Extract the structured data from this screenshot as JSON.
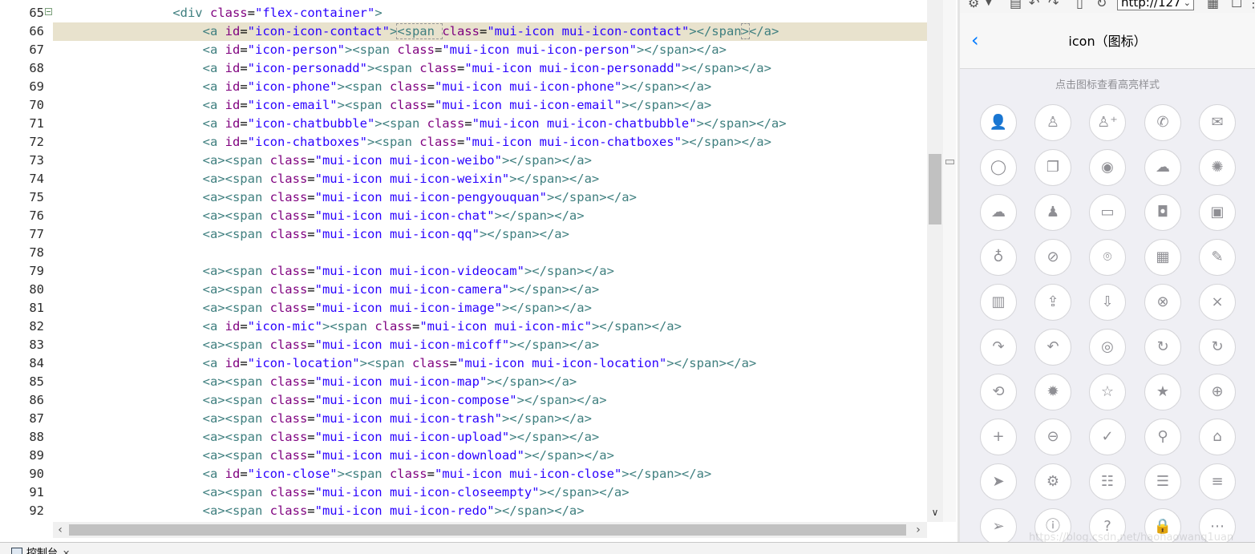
{
  "editor": {
    "highlighted_line": 66,
    "lines": [
      {
        "no": "65",
        "segs": [
          [
            "t",
            "                "
          ],
          [
            "t",
            "<div "
          ],
          [
            "an",
            "class"
          ],
          [
            "eq",
            "="
          ],
          [
            "av",
            "\"flex-container\""
          ],
          [
            "t",
            ">"
          ]
        ]
      },
      {
        "no": "66",
        "segs": [
          [
            "t",
            "                    <a "
          ],
          [
            "an",
            "id"
          ],
          [
            "eq",
            "="
          ],
          [
            "av",
            "\"icon-icon-contact\""
          ],
          [
            "t",
            ">"
          ],
          [
            "bx",
            "<span "
          ],
          [
            "an",
            "class"
          ],
          [
            "eq",
            "="
          ],
          [
            "av",
            "\"mui-icon mui-icon-contact\""
          ],
          [
            "t",
            "></span"
          ],
          [
            "bx",
            ">"
          ],
          [
            "t",
            "</a>"
          ]
        ]
      },
      {
        "no": "67",
        "segs": [
          [
            "t",
            "                    <a "
          ],
          [
            "an",
            "id"
          ],
          [
            "eq",
            "="
          ],
          [
            "av",
            "\"icon-person\""
          ],
          [
            "t",
            "><span "
          ],
          [
            "an",
            "class"
          ],
          [
            "eq",
            "="
          ],
          [
            "av",
            "\"mui-icon mui-icon-person\""
          ],
          [
            "t",
            "></span></a>"
          ]
        ]
      },
      {
        "no": "68",
        "segs": [
          [
            "t",
            "                    <a "
          ],
          [
            "an",
            "id"
          ],
          [
            "eq",
            "="
          ],
          [
            "av",
            "\"icon-personadd\""
          ],
          [
            "t",
            "><span "
          ],
          [
            "an",
            "class"
          ],
          [
            "eq",
            "="
          ],
          [
            "av",
            "\"mui-icon mui-icon-personadd\""
          ],
          [
            "t",
            "></span></a>"
          ]
        ]
      },
      {
        "no": "69",
        "segs": [
          [
            "t",
            "                    <a "
          ],
          [
            "an",
            "id"
          ],
          [
            "eq",
            "="
          ],
          [
            "av",
            "\"icon-phone\""
          ],
          [
            "t",
            "><span "
          ],
          [
            "an",
            "class"
          ],
          [
            "eq",
            "="
          ],
          [
            "av",
            "\"mui-icon mui-icon-phone\""
          ],
          [
            "t",
            "></span></a>"
          ]
        ]
      },
      {
        "no": "70",
        "segs": [
          [
            "t",
            "                    <a "
          ],
          [
            "an",
            "id"
          ],
          [
            "eq",
            "="
          ],
          [
            "av",
            "\"icon-email\""
          ],
          [
            "t",
            "><span "
          ],
          [
            "an",
            "class"
          ],
          [
            "eq",
            "="
          ],
          [
            "av",
            "\"mui-icon mui-icon-email\""
          ],
          [
            "t",
            "></span></a>"
          ]
        ]
      },
      {
        "no": "71",
        "segs": [
          [
            "t",
            "                    <a "
          ],
          [
            "an",
            "id"
          ],
          [
            "eq",
            "="
          ],
          [
            "av",
            "\"icon-chatbubble\""
          ],
          [
            "t",
            "><span "
          ],
          [
            "an",
            "class"
          ],
          [
            "eq",
            "="
          ],
          [
            "av",
            "\"mui-icon mui-icon-chatbubble\""
          ],
          [
            "t",
            "></span></a>"
          ]
        ]
      },
      {
        "no": "72",
        "segs": [
          [
            "t",
            "                    <a "
          ],
          [
            "an",
            "id"
          ],
          [
            "eq",
            "="
          ],
          [
            "av",
            "\"icon-chatboxes\""
          ],
          [
            "t",
            "><span "
          ],
          [
            "an",
            "class"
          ],
          [
            "eq",
            "="
          ],
          [
            "av",
            "\"mui-icon mui-icon-chatboxes\""
          ],
          [
            "t",
            "></span></a>"
          ]
        ]
      },
      {
        "no": "73",
        "segs": [
          [
            "t",
            "                    <a><span "
          ],
          [
            "an",
            "class"
          ],
          [
            "eq",
            "="
          ],
          [
            "av",
            "\"mui-icon mui-icon-weibo\""
          ],
          [
            "t",
            "></span></a>"
          ]
        ]
      },
      {
        "no": "74",
        "segs": [
          [
            "t",
            "                    <a><span "
          ],
          [
            "an",
            "class"
          ],
          [
            "eq",
            "="
          ],
          [
            "av",
            "\"mui-icon mui-icon-weixin\""
          ],
          [
            "t",
            "></span></a>"
          ]
        ]
      },
      {
        "no": "75",
        "segs": [
          [
            "t",
            "                    <a><span "
          ],
          [
            "an",
            "class"
          ],
          [
            "eq",
            "="
          ],
          [
            "av",
            "\"mui-icon mui-icon-pengyouquan\""
          ],
          [
            "t",
            "></span></a>"
          ]
        ]
      },
      {
        "no": "76",
        "segs": [
          [
            "t",
            "                    <a><span "
          ],
          [
            "an",
            "class"
          ],
          [
            "eq",
            "="
          ],
          [
            "av",
            "\"mui-icon mui-icon-chat\""
          ],
          [
            "t",
            "></span></a>"
          ]
        ]
      },
      {
        "no": "77",
        "segs": [
          [
            "t",
            "                    <a><span "
          ],
          [
            "an",
            "class"
          ],
          [
            "eq",
            "="
          ],
          [
            "av",
            "\"mui-icon mui-icon-qq\""
          ],
          [
            "t",
            "></span></a>"
          ]
        ]
      },
      {
        "no": "78",
        "segs": []
      },
      {
        "no": "79",
        "segs": [
          [
            "t",
            "                    <a><span "
          ],
          [
            "an",
            "class"
          ],
          [
            "eq",
            "="
          ],
          [
            "av",
            "\"mui-icon mui-icon-videocam\""
          ],
          [
            "t",
            "></span></a>"
          ]
        ]
      },
      {
        "no": "80",
        "segs": [
          [
            "t",
            "                    <a><span "
          ],
          [
            "an",
            "class"
          ],
          [
            "eq",
            "="
          ],
          [
            "av",
            "\"mui-icon mui-icon-camera\""
          ],
          [
            "t",
            "></span></a>"
          ]
        ]
      },
      {
        "no": "81",
        "segs": [
          [
            "t",
            "                    <a><span "
          ],
          [
            "an",
            "class"
          ],
          [
            "eq",
            "="
          ],
          [
            "av",
            "\"mui-icon mui-icon-image\""
          ],
          [
            "t",
            "></span></a>"
          ]
        ]
      },
      {
        "no": "82",
        "segs": [
          [
            "t",
            "                    <a "
          ],
          [
            "an",
            "id"
          ],
          [
            "eq",
            "="
          ],
          [
            "av",
            "\"icon-mic\""
          ],
          [
            "t",
            "><span "
          ],
          [
            "an",
            "class"
          ],
          [
            "eq",
            "="
          ],
          [
            "av",
            "\"mui-icon mui-icon-mic\""
          ],
          [
            "t",
            "></span></a>"
          ]
        ]
      },
      {
        "no": "83",
        "segs": [
          [
            "t",
            "                    <a><span "
          ],
          [
            "an",
            "class"
          ],
          [
            "eq",
            "="
          ],
          [
            "av",
            "\"mui-icon mui-icon-micoff\""
          ],
          [
            "t",
            "></span></a>"
          ]
        ]
      },
      {
        "no": "84",
        "segs": [
          [
            "t",
            "                    <a "
          ],
          [
            "an",
            "id"
          ],
          [
            "eq",
            "="
          ],
          [
            "av",
            "\"icon-location\""
          ],
          [
            "t",
            "><span "
          ],
          [
            "an",
            "class"
          ],
          [
            "eq",
            "="
          ],
          [
            "av",
            "\"mui-icon mui-icon-location\""
          ],
          [
            "t",
            "></span></a>"
          ]
        ]
      },
      {
        "no": "85",
        "segs": [
          [
            "t",
            "                    <a><span "
          ],
          [
            "an",
            "class"
          ],
          [
            "eq",
            "="
          ],
          [
            "av",
            "\"mui-icon mui-icon-map\""
          ],
          [
            "t",
            "></span></a>"
          ]
        ]
      },
      {
        "no": "86",
        "segs": [
          [
            "t",
            "                    <a><span "
          ],
          [
            "an",
            "class"
          ],
          [
            "eq",
            "="
          ],
          [
            "av",
            "\"mui-icon mui-icon-compose\""
          ],
          [
            "t",
            "></span></a>"
          ]
        ]
      },
      {
        "no": "87",
        "segs": [
          [
            "t",
            "                    <a><span "
          ],
          [
            "an",
            "class"
          ],
          [
            "eq",
            "="
          ],
          [
            "av",
            "\"mui-icon mui-icon-trash\""
          ],
          [
            "t",
            "></span></a>"
          ]
        ]
      },
      {
        "no": "88",
        "segs": [
          [
            "t",
            "                    <a><span "
          ],
          [
            "an",
            "class"
          ],
          [
            "eq",
            "="
          ],
          [
            "av",
            "\"mui-icon mui-icon-upload\""
          ],
          [
            "t",
            "></span></a>"
          ]
        ]
      },
      {
        "no": "89",
        "segs": [
          [
            "t",
            "                    <a><span "
          ],
          [
            "an",
            "class"
          ],
          [
            "eq",
            "="
          ],
          [
            "av",
            "\"mui-icon mui-icon-download\""
          ],
          [
            "t",
            "></span></a>"
          ]
        ]
      },
      {
        "no": "90",
        "segs": [
          [
            "t",
            "                    <a "
          ],
          [
            "an",
            "id"
          ],
          [
            "eq",
            "="
          ],
          [
            "av",
            "\"icon-close\""
          ],
          [
            "t",
            "><span "
          ],
          [
            "an",
            "class"
          ],
          [
            "eq",
            "="
          ],
          [
            "av",
            "\"mui-icon mui-icon-close\""
          ],
          [
            "t",
            "></span></a>"
          ]
        ]
      },
      {
        "no": "91",
        "segs": [
          [
            "t",
            "                    <a><span "
          ],
          [
            "an",
            "class"
          ],
          [
            "eq",
            "="
          ],
          [
            "av",
            "\"mui-icon mui-icon-closeempty\""
          ],
          [
            "t",
            "></span></a>"
          ]
        ]
      },
      {
        "no": "92",
        "segs": [
          [
            "t",
            "                    <a><span "
          ],
          [
            "an",
            "class"
          ],
          [
            "eq",
            "="
          ],
          [
            "av",
            "\"mui-icon mui-icon-redo\""
          ],
          [
            "t",
            "></span></a>"
          ]
        ]
      }
    ]
  },
  "console": {
    "tab_label": "控制台",
    "close": "✕"
  },
  "preview": {
    "url": "http://127",
    "back": "‹",
    "title": "icon（图标）",
    "tip": "点击图标查看高亮样式",
    "watermark": "https://blog.csdn.net/haohaowang1uan",
    "icons": [
      {
        "name": "contact-icon",
        "glyph": "👤"
      },
      {
        "name": "person-icon",
        "glyph": "♙"
      },
      {
        "name": "personadd-icon",
        "glyph": "♙⁺"
      },
      {
        "name": "phone-icon",
        "glyph": "✆"
      },
      {
        "name": "email-icon",
        "glyph": "✉"
      },
      {
        "name": "chatbubble-icon",
        "glyph": "◯"
      },
      {
        "name": "chatboxes-icon",
        "glyph": "❐"
      },
      {
        "name": "weibo-icon",
        "glyph": "◉"
      },
      {
        "name": "weixin-icon",
        "glyph": "☁"
      },
      {
        "name": "pengyouquan-icon",
        "glyph": "✺"
      },
      {
        "name": "chat-icon",
        "glyph": "☁"
      },
      {
        "name": "qq-icon",
        "glyph": "♟"
      },
      {
        "name": "videocam-icon",
        "glyph": "▭"
      },
      {
        "name": "camera-icon",
        "glyph": "◘"
      },
      {
        "name": "image-icon",
        "glyph": "▣"
      },
      {
        "name": "mic-icon",
        "glyph": "♁"
      },
      {
        "name": "micoff-icon",
        "glyph": "⊘"
      },
      {
        "name": "location-icon",
        "glyph": "⌾"
      },
      {
        "name": "map-icon",
        "glyph": "▦"
      },
      {
        "name": "compose-icon",
        "glyph": "✎"
      },
      {
        "name": "trash-icon",
        "glyph": "▥"
      },
      {
        "name": "upload-icon",
        "glyph": "⇪"
      },
      {
        "name": "download-icon",
        "glyph": "⇩"
      },
      {
        "name": "close-icon",
        "glyph": "⊗"
      },
      {
        "name": "closeempty-icon",
        "glyph": "×"
      },
      {
        "name": "redo-icon",
        "glyph": "↷"
      },
      {
        "name": "undo-icon",
        "glyph": "↶"
      },
      {
        "name": "refresh-icon",
        "glyph": "◎"
      },
      {
        "name": "refreshempty-icon",
        "glyph": "↻"
      },
      {
        "name": "reload-icon",
        "glyph": "↻"
      },
      {
        "name": "loop-icon",
        "glyph": "⟲"
      },
      {
        "name": "spinner-icon",
        "glyph": "✹"
      },
      {
        "name": "star-icon",
        "glyph": "☆"
      },
      {
        "name": "starhalf-icon",
        "glyph": "★"
      },
      {
        "name": "plus-circle-icon",
        "glyph": "⊕"
      },
      {
        "name": "plus-icon",
        "glyph": "+"
      },
      {
        "name": "minus-icon",
        "glyph": "⊖"
      },
      {
        "name": "checkmark-icon",
        "glyph": "✓"
      },
      {
        "name": "search-icon",
        "glyph": "⚲"
      },
      {
        "name": "home-icon",
        "glyph": "⌂"
      },
      {
        "name": "navigate-icon",
        "glyph": "➤"
      },
      {
        "name": "gear-icon",
        "glyph": "⚙"
      },
      {
        "name": "settings-icon",
        "glyph": "☷"
      },
      {
        "name": "list-icon",
        "glyph": "☰"
      },
      {
        "name": "bars-icon",
        "glyph": "≡"
      },
      {
        "name": "paperplane-icon",
        "glyph": "➢"
      },
      {
        "name": "info-icon",
        "glyph": "ⓘ"
      },
      {
        "name": "help-icon",
        "glyph": "?"
      },
      {
        "name": "locked-icon",
        "glyph": "🔒"
      },
      {
        "name": "more-icon",
        "glyph": "⋯"
      }
    ]
  }
}
